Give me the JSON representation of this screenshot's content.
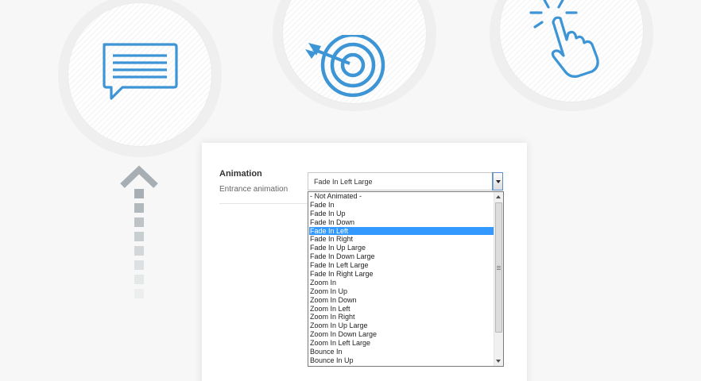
{
  "icons": {
    "left": "speech-bubble-icon",
    "middle": "target-dart-icon",
    "right": "hand-click-icon",
    "accent_color": "#3d95d6"
  },
  "field": {
    "label": "Animation",
    "description": "Entrance animation",
    "selected_value": "Fade In Left Large"
  },
  "dropdown": {
    "highlighted_index": 4,
    "options": [
      "- Not Animated -",
      "Fade In",
      "Fade In Up",
      "Fade In Down",
      "Fade In Left",
      "Fade In Right",
      "Fade In Up Large",
      "Fade In Down Large",
      "Fade In Left Large",
      "Fade In Right Large",
      "Zoom In",
      "Zoom In Up",
      "Zoom In Down",
      "Zoom In Left",
      "Zoom In Right",
      "Zoom In Up Large",
      "Zoom In Down Large",
      "Zoom In Left Large",
      "Bounce In",
      "Bounce In Up"
    ],
    "highlight_color": "#3399ff"
  }
}
